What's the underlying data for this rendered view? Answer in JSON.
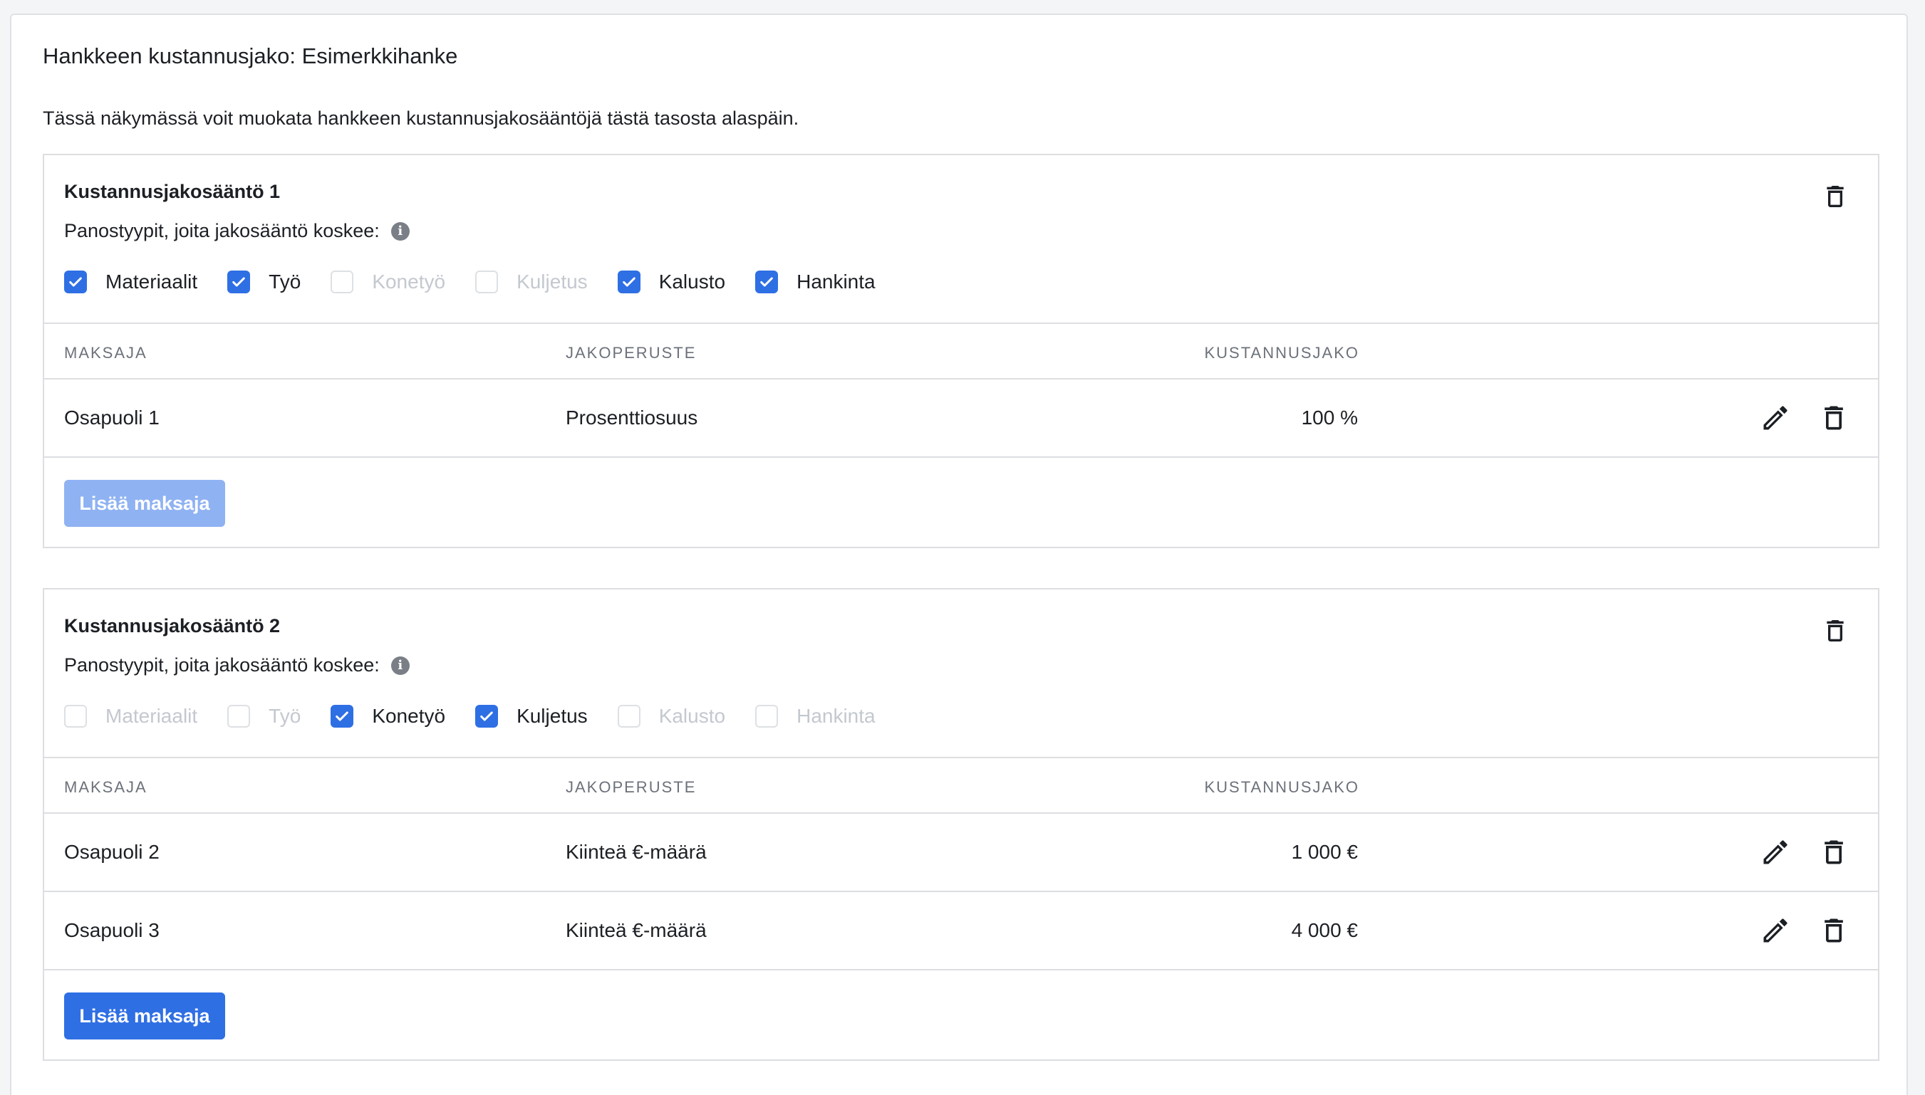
{
  "page": {
    "title": "Hankkeen kustannusjako: Esimerkkihanke",
    "description": "Tässä näkymässä voit muokata hankkeen kustannusjakosääntöjä tästä tasosta alaspäin."
  },
  "table_headers": {
    "payer": "MAKSAJA",
    "basis": "JAKOPERUSTE",
    "share": "KUSTANNUSJAKO"
  },
  "rules": [
    {
      "title": "Kustannusjakosääntö 1",
      "subtitle": "Panostyypit, joita jakosääntö koskee:",
      "input_types": [
        {
          "label": "Materiaalit",
          "checked": true
        },
        {
          "label": "Työ",
          "checked": true
        },
        {
          "label": "Konetyö",
          "checked": false
        },
        {
          "label": "Kuljetus",
          "checked": false
        },
        {
          "label": "Kalusto",
          "checked": true
        },
        {
          "label": "Hankinta",
          "checked": true
        }
      ],
      "rows": [
        {
          "payer": "Osapuoli 1",
          "basis": "Prosenttiosuus",
          "share": "100 %"
        }
      ],
      "add_button": {
        "label": "Lisää maksaja",
        "enabled": false
      }
    },
    {
      "title": "Kustannusjakosääntö 2",
      "subtitle": "Panostyypit, joita jakosääntö koskee:",
      "input_types": [
        {
          "label": "Materiaalit",
          "checked": false
        },
        {
          "label": "Työ",
          "checked": false
        },
        {
          "label": "Konetyö",
          "checked": true
        },
        {
          "label": "Kuljetus",
          "checked": true
        },
        {
          "label": "Kalusto",
          "checked": false
        },
        {
          "label": "Hankinta",
          "checked": false
        }
      ],
      "rows": [
        {
          "payer": "Osapuoli 2",
          "basis": "Kiinteä €-määrä",
          "share": "1 000 €"
        },
        {
          "payer": "Osapuoli 3",
          "basis": "Kiinteä €-määrä",
          "share": "4 000 €"
        }
      ],
      "add_button": {
        "label": "Lisää maksaja",
        "enabled": true
      }
    }
  ],
  "colors": {
    "accent": "#2f6fe4",
    "accent_disabled": "#8fb2f2",
    "border": "#dcdee2"
  },
  "icons": {
    "info": "info-icon",
    "edit": "pencil-icon",
    "delete": "trash-icon",
    "check": "check-icon"
  }
}
